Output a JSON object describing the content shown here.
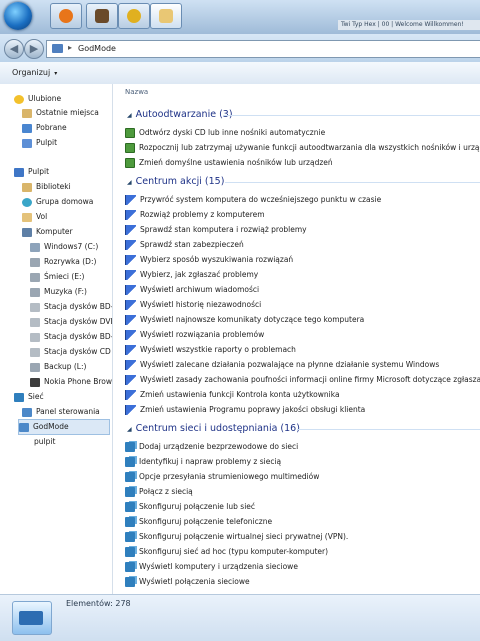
{
  "taskbar": {
    "apps": [
      {
        "icon": "firefox-icon",
        "color": "#e8751a"
      },
      {
        "icon": "game-icon",
        "color": "#6a4a2a"
      },
      {
        "icon": "media-icon",
        "color": "#e0b020"
      },
      {
        "icon": "folder-icon",
        "color": "#e9c774"
      }
    ],
    "ticker": "Twi Typ Hex | 00 | Welcome Willkommen!"
  },
  "address": {
    "path": "GodMode",
    "separator": "▸"
  },
  "commandbar": {
    "organize": "Organizuj",
    "caret": "▾"
  },
  "nav": {
    "favorites": "Ulubione",
    "fav_items": [
      "Ostatnie miejsca",
      "Pobrane",
      "Pulpit"
    ],
    "desktop": "Pulpit",
    "desktop_items": [
      "Biblioteki",
      "Grupa domowa",
      "Vol",
      "Komputer"
    ],
    "drives": [
      "Windows7 (C:)",
      "Rozrywka (D:)",
      "Śmieci (E:)",
      "Muzyka (F:)",
      "Stacja dysków BD-",
      "Stacja dysków DVD",
      "Stacja dysków BD-",
      "Stacja dysków CD",
      "Backup (L:)",
      "Nokia Phone Brow"
    ],
    "others": [
      "Sieć",
      "Panel sterowania",
      "GodMode",
      "pulpit"
    ]
  },
  "content": {
    "column_header": "Nazwa",
    "groups": [
      {
        "title": "Autoodtwarzanie (3)",
        "icon": "autoplay-icon",
        "items": [
          "Odtwórz dyski CD lub inne nośniki automatycznie",
          "Rozpocznij lub zatrzymaj używanie funkcji autoodtwarzania dla wszystkich nośników i urządzeń",
          "Zmień domyślne ustawienia nośników lub urządzeń"
        ]
      },
      {
        "title": "Centrum akcji (15)",
        "icon": "flag-icon",
        "items": [
          "Przywróć system komputera do wcześniejszego punktu w czasie",
          "Rozwiąż problemy z komputerem",
          "Sprawdź stan komputera i rozwiąż problemy",
          "Sprawdź stan zabezpieczeń",
          "Wybierz sposób wyszukiwania rozwiązań",
          "Wybierz, jak zgłaszać problemy",
          "Wyświetl archiwum wiadomości",
          "Wyświetl historię niezawodności",
          "Wyświetl najnowsze komunikaty dotyczące tego komputera",
          "Wyświetl rozwiązania problemów",
          "Wyświetl wszystkie raporty o problemach",
          "Wyświetl zalecane działania pozwalające na płynne działanie systemu Windows",
          "Wyświetl zasady zachowania poufności informacji online firmy Microsoft dotyczące zgłaszania",
          "Zmień ustawienia funkcji Kontrola konta użytkownika",
          "Zmień ustawienia Programu poprawy jakości obsługi klienta"
        ]
      },
      {
        "title": "Centrum sieci i udostępniania (16)",
        "icon": "network-icon",
        "items": [
          "Dodaj urządzenie bezprzewodowe do sieci",
          "Identyfikuj i napraw problemy z siecią",
          "Opcje przesyłania strumieniowego multimediów",
          "Połącz z siecią",
          "Skonfiguruj połączenie lub sieć",
          "Skonfiguruj połączenie telefoniczne",
          "Skonfiguruj połączenie wirtualnej sieci prywatnej (VPN).",
          "Skonfiguruj sieć ad hoc (typu komputer-komputer)",
          "Wyświetl komputery i urządzenia sieciowe",
          "Wyświetl połączenia sieciowe"
        ]
      }
    ]
  },
  "status": {
    "count": "Elementów: 278"
  }
}
